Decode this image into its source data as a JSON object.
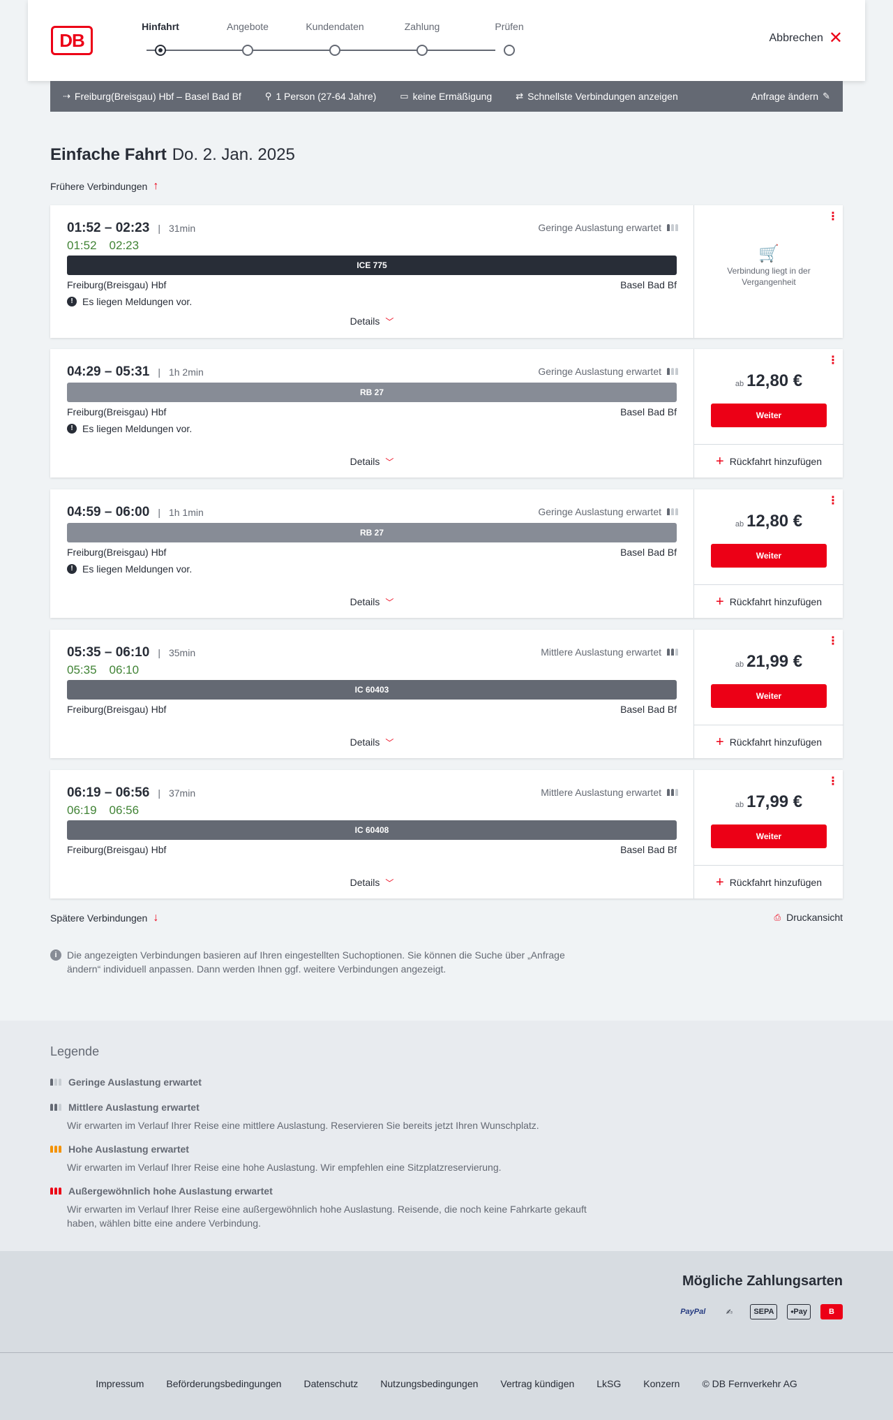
{
  "header": {
    "logo": "DB",
    "steps": [
      "Hinfahrt",
      "Angebote",
      "Kundendaten",
      "Zahlung",
      "Prüfen"
    ],
    "cancel_label": "Abbrechen"
  },
  "search": {
    "route": "Freiburg(Breisgau) Hbf – Basel Bad Bf",
    "passengers": "1 Person (27-64 Jahre)",
    "discount": "keine Ermäßigung",
    "fastest": "Schnellste Verbindungen anzeigen",
    "edit": "Anfrage ändern"
  },
  "title": {
    "type": "Einfache Fahrt",
    "date": "Do. 2. Jan. 2025"
  },
  "earlier": "Frühere Verbindungen",
  "later": "Spätere Verbindungen",
  "print": "Druckansicht",
  "connections": [
    {
      "times": "01:52 – 02:23",
      "duration": "31min",
      "rt_dep": "01:52",
      "rt_arr": "02:23",
      "load": "Geringe Auslastung erwartet",
      "train": "ICE 775",
      "from": "Freiburg(Breisgau) Hbf",
      "to": "Basel Bad Bf",
      "message": "Es liegen Meldungen vor.",
      "details": "Details",
      "past": "Verbindung liegt in der Vergangenheit"
    },
    {
      "times": "04:29 – 05:31",
      "duration": "1h 2min",
      "load": "Geringe Auslastung erwartet",
      "train": "RB 27",
      "from": "Freiburg(Breisgau) Hbf",
      "to": "Basel Bad Bf",
      "message": "Es liegen Meldungen vor.",
      "details": "Details",
      "price_prefix": "ab",
      "price": "12,80 €",
      "continue": "Weiter",
      "return": "Rückfahrt hinzufügen"
    },
    {
      "times": "04:59 – 06:00",
      "duration": "1h 1min",
      "load": "Geringe Auslastung erwartet",
      "train": "RB 27",
      "from": "Freiburg(Breisgau) Hbf",
      "to": "Basel Bad Bf",
      "message": "Es liegen Meldungen vor.",
      "details": "Details",
      "price_prefix": "ab",
      "price": "12,80 €",
      "continue": "Weiter",
      "return": "Rückfahrt hinzufügen"
    },
    {
      "times": "05:35 – 06:10",
      "duration": "35min",
      "rt_dep": "05:35",
      "rt_arr": "06:10",
      "load": "Mittlere Auslastung erwartet",
      "train": "IC 60403",
      "from": "Freiburg(Breisgau) Hbf",
      "to": "Basel Bad Bf",
      "details": "Details",
      "price_prefix": "ab",
      "price": "21,99 €",
      "continue": "Weiter",
      "return": "Rückfahrt hinzufügen"
    },
    {
      "times": "06:19 – 06:56",
      "duration": "37min",
      "rt_dep": "06:19",
      "rt_arr": "06:56",
      "load": "Mittlere Auslastung erwartet",
      "train": "IC 60408",
      "from": "Freiburg(Breisgau) Hbf",
      "to": "Basel Bad Bf",
      "details": "Details",
      "price_prefix": "ab",
      "price": "17,99 €",
      "continue": "Weiter",
      "return": "Rückfahrt hinzufügen"
    }
  ],
  "info": "Die angezeigten Verbindungen basieren auf Ihren eingestellten Suchoptionen. Sie können die Suche über „Anfrage ändern“ individuell anpassen. Dann werden Ihnen ggf. weitere Verbindungen angezeigt.",
  "legend": {
    "title": "Legende",
    "items": [
      {
        "title": "Geringe Auslastung erwartet",
        "desc": ""
      },
      {
        "title": "Mittlere Auslastung erwartet",
        "desc": "Wir erwarten im Verlauf Ihrer Reise eine mittlere Auslastung. Reservieren Sie bereits jetzt Ihren Wunschplatz."
      },
      {
        "title": "Hohe Auslastung erwartet",
        "desc": "Wir erwarten im Verlauf Ihrer Reise eine hohe Auslastung. Wir empfehlen eine Sitzplatzreservierung."
      },
      {
        "title": "Außergewöhnlich hohe Auslastung erwartet",
        "desc": "Wir erwarten im Verlauf Ihrer Reise eine außergewöhnlich hohe Auslastung. Reisende, die noch keine Fahrkarte gekauft haben, wählen bitte eine andere Verbindung."
      }
    ]
  },
  "payment": {
    "title": "Mögliche Zahlungsarten",
    "methods": [
      "PayPal",
      "credit-card-icon",
      "SEPA",
      "Pay",
      "db-icon"
    ]
  },
  "footer": [
    "Impressum",
    "Beförderungsbedingungen",
    "Datenschutz",
    "Nutzungsbedingungen",
    "Vertrag kündigen",
    "LkSG",
    "Konzern",
    "© DB Fernverkehr AG"
  ],
  "colors": {
    "brand_red": "#ec0016",
    "realtime_green": "#408335",
    "bar_ice": "#282d37",
    "bar_rb": "#878c96",
    "bar_ic": "#646973"
  }
}
